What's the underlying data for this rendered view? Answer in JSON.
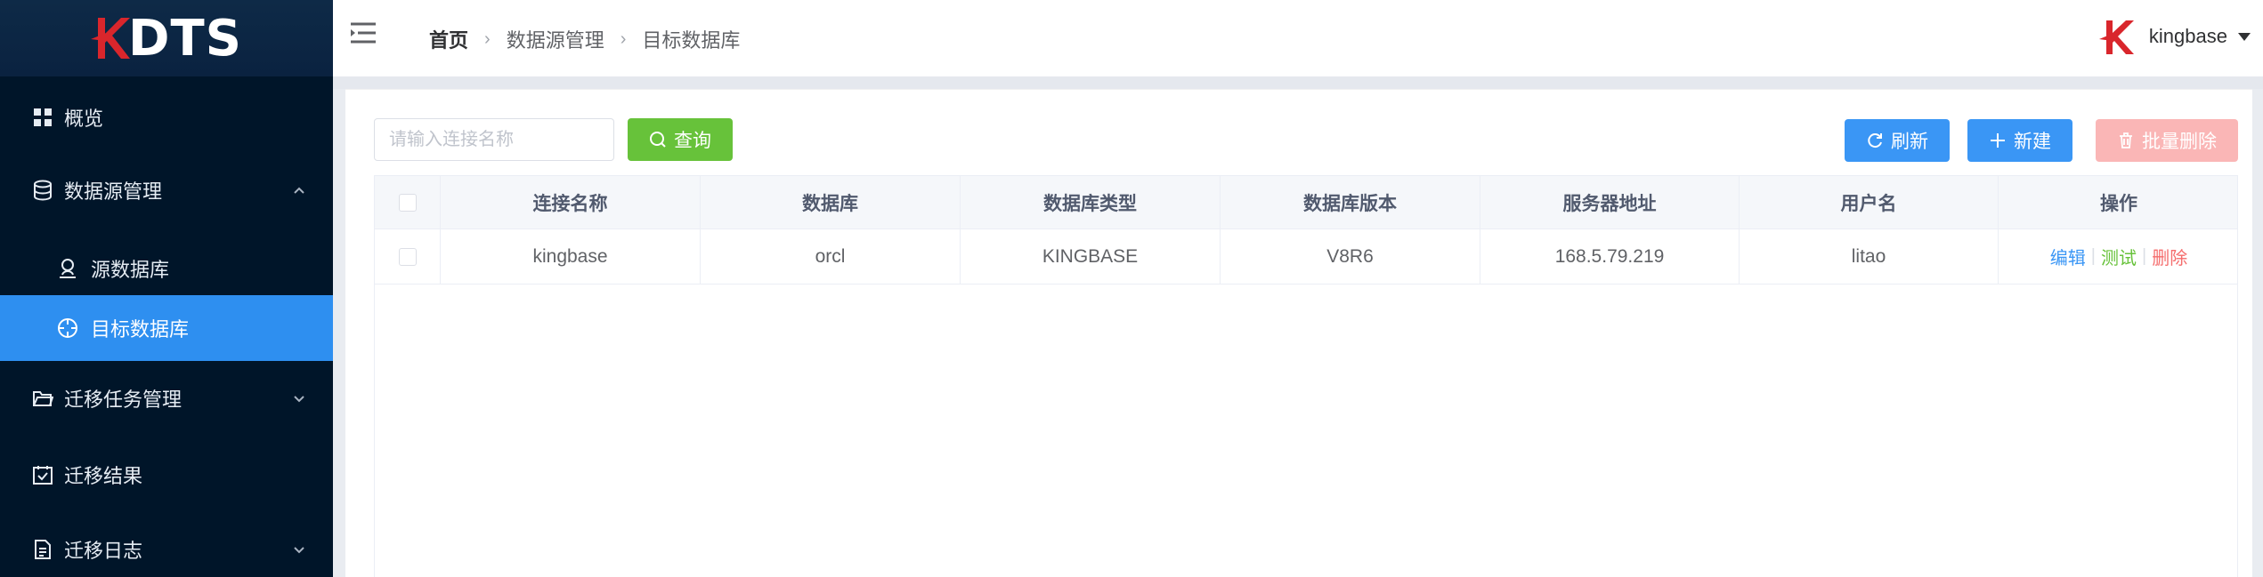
{
  "app": {
    "logo_text": "DTS"
  },
  "sidebar": {
    "items": [
      {
        "label": "概览",
        "icon": "dashboard-icon"
      },
      {
        "label": "数据源管理",
        "icon": "database-icon",
        "expanded": true
      },
      {
        "label": "源数据库",
        "icon": "user-icon",
        "sub": true
      },
      {
        "label": "目标数据库",
        "icon": "target-icon",
        "sub": true,
        "active": true
      },
      {
        "label": "迁移任务管理",
        "icon": "folder-icon",
        "expanded": false
      },
      {
        "label": "迁移结果",
        "icon": "check-calendar-icon"
      },
      {
        "label": "迁移日志",
        "icon": "document-icon",
        "expanded": false
      }
    ]
  },
  "header": {
    "breadcrumb": [
      "首页",
      "数据源管理",
      "目标数据库"
    ],
    "user": "kingbase"
  },
  "toolbar": {
    "search_placeholder": "请输入连接名称",
    "query_label": "查询",
    "refresh_label": "刷新",
    "new_label": "新建",
    "batch_delete_label": "批量删除"
  },
  "table": {
    "columns": [
      "连接名称",
      "数据库",
      "数据库类型",
      "数据库版本",
      "服务器地址",
      "用户名",
      "操作"
    ],
    "rows": [
      {
        "name": "kingbase",
        "database": "orcl",
        "type": "KINGBASE",
        "version": "V8R6",
        "address": "168.5.79.219",
        "user": "litao"
      }
    ],
    "actions": {
      "edit": "编辑",
      "test": "测试",
      "delete": "删除"
    }
  },
  "colors": {
    "sidebar_bg": "#001529",
    "active_item": "#2e8ff0",
    "primary": "#3a96f5",
    "success": "#67c23a",
    "danger": "#f56c6c",
    "brand_red": "#d9262c"
  }
}
